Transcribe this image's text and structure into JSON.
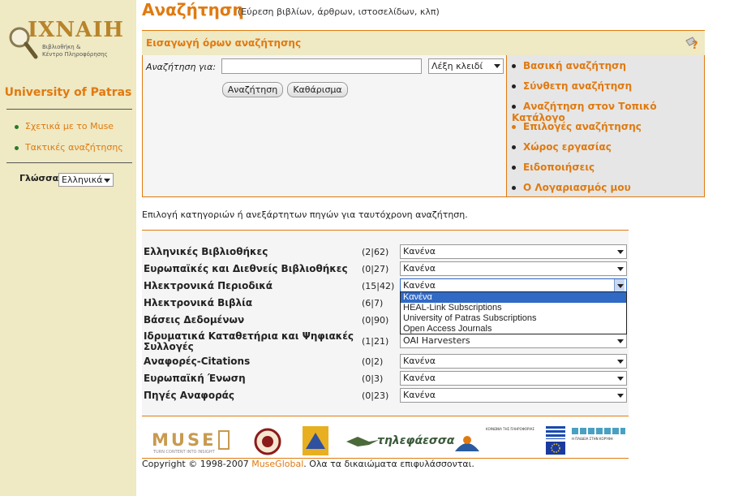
{
  "sidebar": {
    "logo_title": "IXNAIH",
    "logo_line1": "Βιβλιοθήκη &",
    "logo_line2": "Κέντρο Πληροφόρησης",
    "university": "University of Patras",
    "links": [
      "Σχετικά με το Muse",
      "Τακτικές αναζήτησης"
    ],
    "language_label": "Γλώσσα:",
    "language_value": "Ελληνικά"
  },
  "header": {
    "title": "Αναζήτηση",
    "subtitle": "(Εύρεση βιβλίων, άρθρων, ιστοσελίδων, κλπ)"
  },
  "panel": {
    "title": "Εισαγωγή όρων αναζήτησης",
    "help_symbol": "?"
  },
  "search": {
    "label": "Αναζήτηση για:",
    "input_value": "",
    "field_value": "Λέξη κλειδί",
    "search_button": "Αναζήτηση",
    "clear_button": "Καθάρισμα"
  },
  "right_links": [
    "Βασική αναζήτηση",
    "Σύνθετη αναζήτηση",
    "Αναζήτηση στον Τοπικό Κατάλογο",
    "Επιλογές αναζήτησης",
    "Χώρος εργασίας",
    "Ειδοποιήσεις",
    "Ο Λογαριασμός μου"
  ],
  "intro": "Επιλογή κατηγοριών ή ανεξάρτητων πηγών για ταυτόχρονη αναζήτηση.",
  "sources": [
    {
      "name": "Ελληνικές Βιβλιοθήκες",
      "count": "(2|62)",
      "value": "Κανένα"
    },
    {
      "name": "Ευρωπαϊκές και Διεθνείς Βιβλιοθήκες",
      "count": "(0|27)",
      "value": "Κανένα"
    },
    {
      "name": "Ηλεκτρονικά Περιοδικά",
      "count": "(15|42)",
      "value": "Κανένα"
    },
    {
      "name": "Ηλεκτρονικά Βιβλία",
      "count": "(6|7)",
      "value": ""
    },
    {
      "name": "Βάσεις Δεδομένων",
      "count": "(0|90)",
      "value": ""
    },
    {
      "name": "Ιδρυματικά Καταθετήρια και Ψηφιακές",
      "name2": "Συλλογές",
      "count": "(1|21)",
      "value": "OAI Harvesters"
    },
    {
      "name": "Αναφορές-Citations",
      "count": "(0|2)",
      "value": "Κανένα"
    },
    {
      "name": "Ευρωπαϊκή Ένωση",
      "count": "(0|3)",
      "value": "Κανένα"
    },
    {
      "name": "Πηγές Αναφοράς",
      "count": "(0|23)",
      "value": "Κανένα"
    }
  ],
  "dropdown_options": [
    "Κανένα",
    "HEAL-Link Subscriptions",
    "University of Patras Subscriptions",
    "Open Access Journals"
  ],
  "logos": {
    "muse": "MUSE",
    "muse_tag": "TURN CONTENT INTO INSIGHT",
    "tilefaessa": "τηλεφάεσσα",
    "koinonia": "ΚΟΙΝΩΝΙΑ ΤΗΣ ΠΛΗΡΟΦΟΡΙΑΣ",
    "paideia": "Η ΠΑΙΔΕΙΑ ΣΤΗΝ ΚΟΡΥΦΗ"
  },
  "footer": {
    "pre": "Copyright © 1998-2007 ",
    "link": "MuseGlobal",
    "post": ". Ολα τα δικαιώματα επιφυλάσσονται."
  }
}
